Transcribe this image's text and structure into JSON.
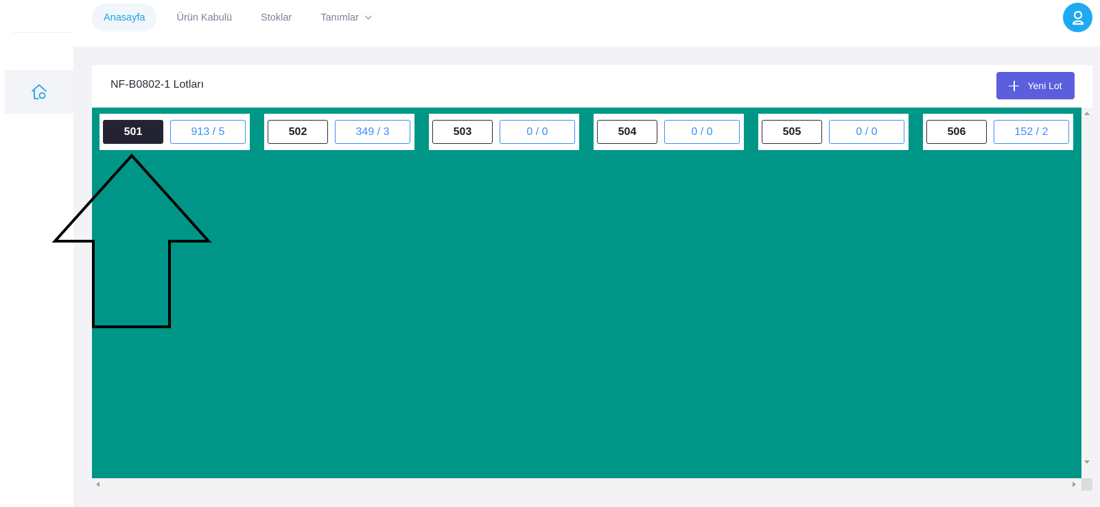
{
  "nav": {
    "items": [
      {
        "label": "Anasayfa",
        "active": true
      },
      {
        "label": "Ürün Kabulü",
        "active": false
      },
      {
        "label": "Stoklar",
        "active": false
      },
      {
        "label": "Tanımlar",
        "active": false,
        "has_dropdown": true
      }
    ]
  },
  "user": {
    "icon": "user-icon",
    "color": "#1eaaf1"
  },
  "sidebar": {
    "items": [
      {
        "icon": "home-icon"
      }
    ]
  },
  "card": {
    "title": "NF-B0802-1 Lotları",
    "new_button_label": "Yeni Lot",
    "accent": "#5b5fdd",
    "board_color": "#009687"
  },
  "lots": [
    {
      "number": "501",
      "qty": "913 / 5",
      "selected": true
    },
    {
      "number": "502",
      "qty": "349 / 3",
      "selected": false
    },
    {
      "number": "503",
      "qty": "0 / 0",
      "selected": false
    },
    {
      "number": "504",
      "qty": "0 / 0",
      "selected": false
    },
    {
      "number": "505",
      "qty": "0 / 0",
      "selected": false
    },
    {
      "number": "506",
      "qty": "152 / 2",
      "selected": false
    }
  ]
}
